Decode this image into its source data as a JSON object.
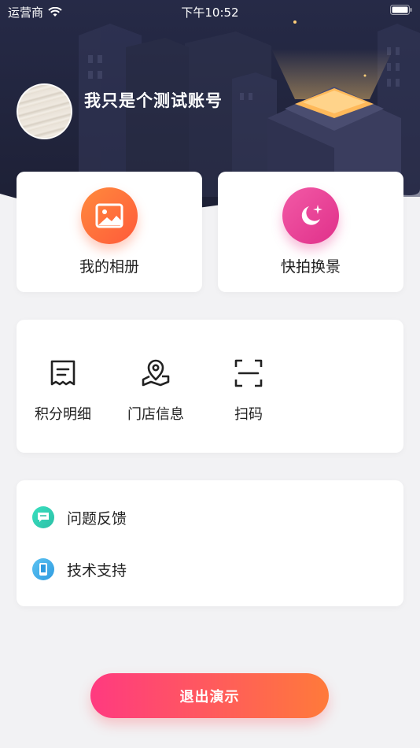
{
  "status_bar": {
    "carrier": "运营商",
    "time": "下午10:52"
  },
  "profile": {
    "username": "我只是个测试账号"
  },
  "features": [
    {
      "label": "我的相册",
      "icon": "photo-icon",
      "color": "#ff6b3d"
    },
    {
      "label": "快拍换景",
      "icon": "moon-sparkle-icon",
      "color": "#e63d95"
    }
  ],
  "tools": [
    {
      "label": "积分明细",
      "icon": "receipt-icon"
    },
    {
      "label": "门店信息",
      "icon": "map-pin-icon"
    },
    {
      "label": "扫码",
      "icon": "scan-icon"
    }
  ],
  "support": [
    {
      "label": "问题反馈",
      "icon": "chat-icon",
      "color": "#2ed6b8"
    },
    {
      "label": "技术支持",
      "icon": "phone-icon",
      "color": "#3aa7e8"
    }
  ],
  "logout_label": "退出演示",
  "colors": {
    "header_bg": "#1f2238",
    "accent_start": "#ff3a80",
    "accent_end": "#ff7a3a"
  }
}
